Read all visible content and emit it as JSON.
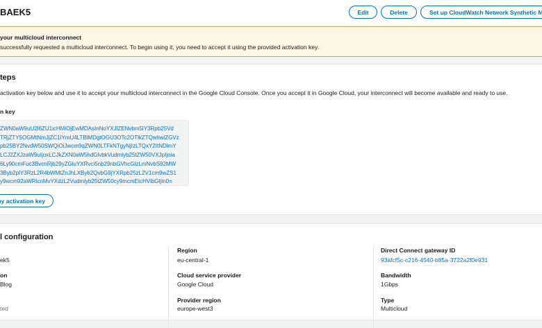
{
  "header": {
    "title": "BAEK5",
    "buttons": {
      "edit": "Edit",
      "delete": "Delete",
      "cloudwatch": "Set up CloudWatch Network Synthetic Mo"
    }
  },
  "banner": {
    "title": "your multicloud interconnect",
    "message": "successfully requested a multicloud interconnect. To begin using it, you need to accept it using the provided activation key.",
    "colors": {
      "background": "#fdf8e6",
      "border": "#c8a65a"
    }
  },
  "next_steps": {
    "title": "teps",
    "description": "activation key below and use it to accept your multicloud interconnect in the Google Cloud Console. Once you accept it in Google Cloud, your interconnect will become available and ready to use.",
    "key_label": "n key",
    "key_lines": [
      "ZWN0aW9uU2l6ZU1icHMiOjEwMDAsInNoYXJlZENvbm5lY3Rpb25Vd",
      "TRjZTY5OGMtNmJjZC1lYmU4LTBlMDgtOGU3OTc2OTlkZTQwIiwiZGVz",
      "pb25BY2NvdW50SWQiOiJwcm9qZWN0LTFkNTgyNjIzLTQxY2ItNDlmY",
      "LCJ2ZXJzaW9uIjoxLCJkZXN0aW5hdGlvbkVudmlyb25tZW50VXJpIjoia",
      "6Ly90cmFuc3BvcnRjb29yZGluYXRvci5nb29nbGVhcGlzLmNvbS92MW",
      "3Byb2plY3RzL2R4bWMtZnJhLXByb2QvbG9jYXRpb25zL2V1cm9wZS1",
      "y9wcm92aWRlcnMvYXdzL2Vudmlyb25tZW50cy9mcmEtcHVibGljIn0="
    ],
    "copy_button": "py activation key"
  },
  "config": {
    "title": "l configuration",
    "columns": [
      [
        {
          "label": "",
          "value": "ek5"
        },
        {
          "label": "on",
          "value": "Blog"
        },
        {
          "label": "",
          "value": "ted"
        }
      ],
      [
        {
          "label": "Region",
          "value": "eu-central-1"
        },
        {
          "label": "Cloud service provider",
          "value": "Google Cloud"
        },
        {
          "label": "Provider region",
          "value": "europe-west3"
        }
      ],
      [
        {
          "label": "Direct Connect gateway ID",
          "value": "93afcf5c-c216-4540-b85a-3722a2f0e931",
          "link": true
        },
        {
          "label": "Bandwidth",
          "value": "1Gbps"
        },
        {
          "label": "Type",
          "value": "Multicloud"
        }
      ]
    ]
  },
  "colors": {
    "accent": "#0073bb"
  }
}
